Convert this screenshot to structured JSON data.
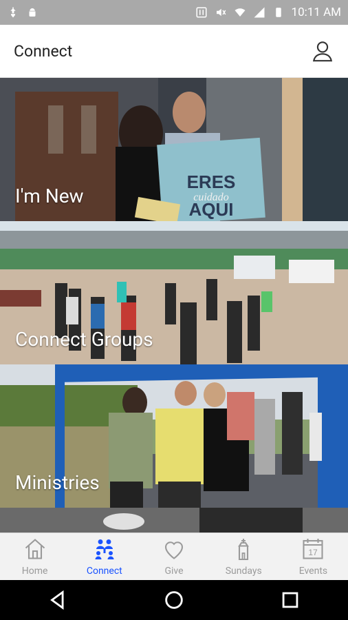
{
  "status": {
    "time": "10:11 AM",
    "icons": [
      "usb-icon",
      "android-icon",
      "nfc-icon",
      "mute-icon",
      "wifi-icon",
      "signal-icon",
      "battery-icon"
    ]
  },
  "header": {
    "title": "Connect"
  },
  "cards": [
    {
      "label": "I'm New",
      "sign_line1": "ERES",
      "sign_line2": "cuidado",
      "sign_line3": "AQUI"
    },
    {
      "label": "Connect Groups"
    },
    {
      "label": "Ministries"
    }
  ],
  "tabs": [
    {
      "label": "Home"
    },
    {
      "label": "Connect"
    },
    {
      "label": "Give"
    },
    {
      "label": "Sundays"
    },
    {
      "label": "Events",
      "day": "17"
    }
  ],
  "colors": {
    "accent": "#1a53ff",
    "inactive": "#9a9a9a",
    "status_bar": "#a9a9a9"
  }
}
